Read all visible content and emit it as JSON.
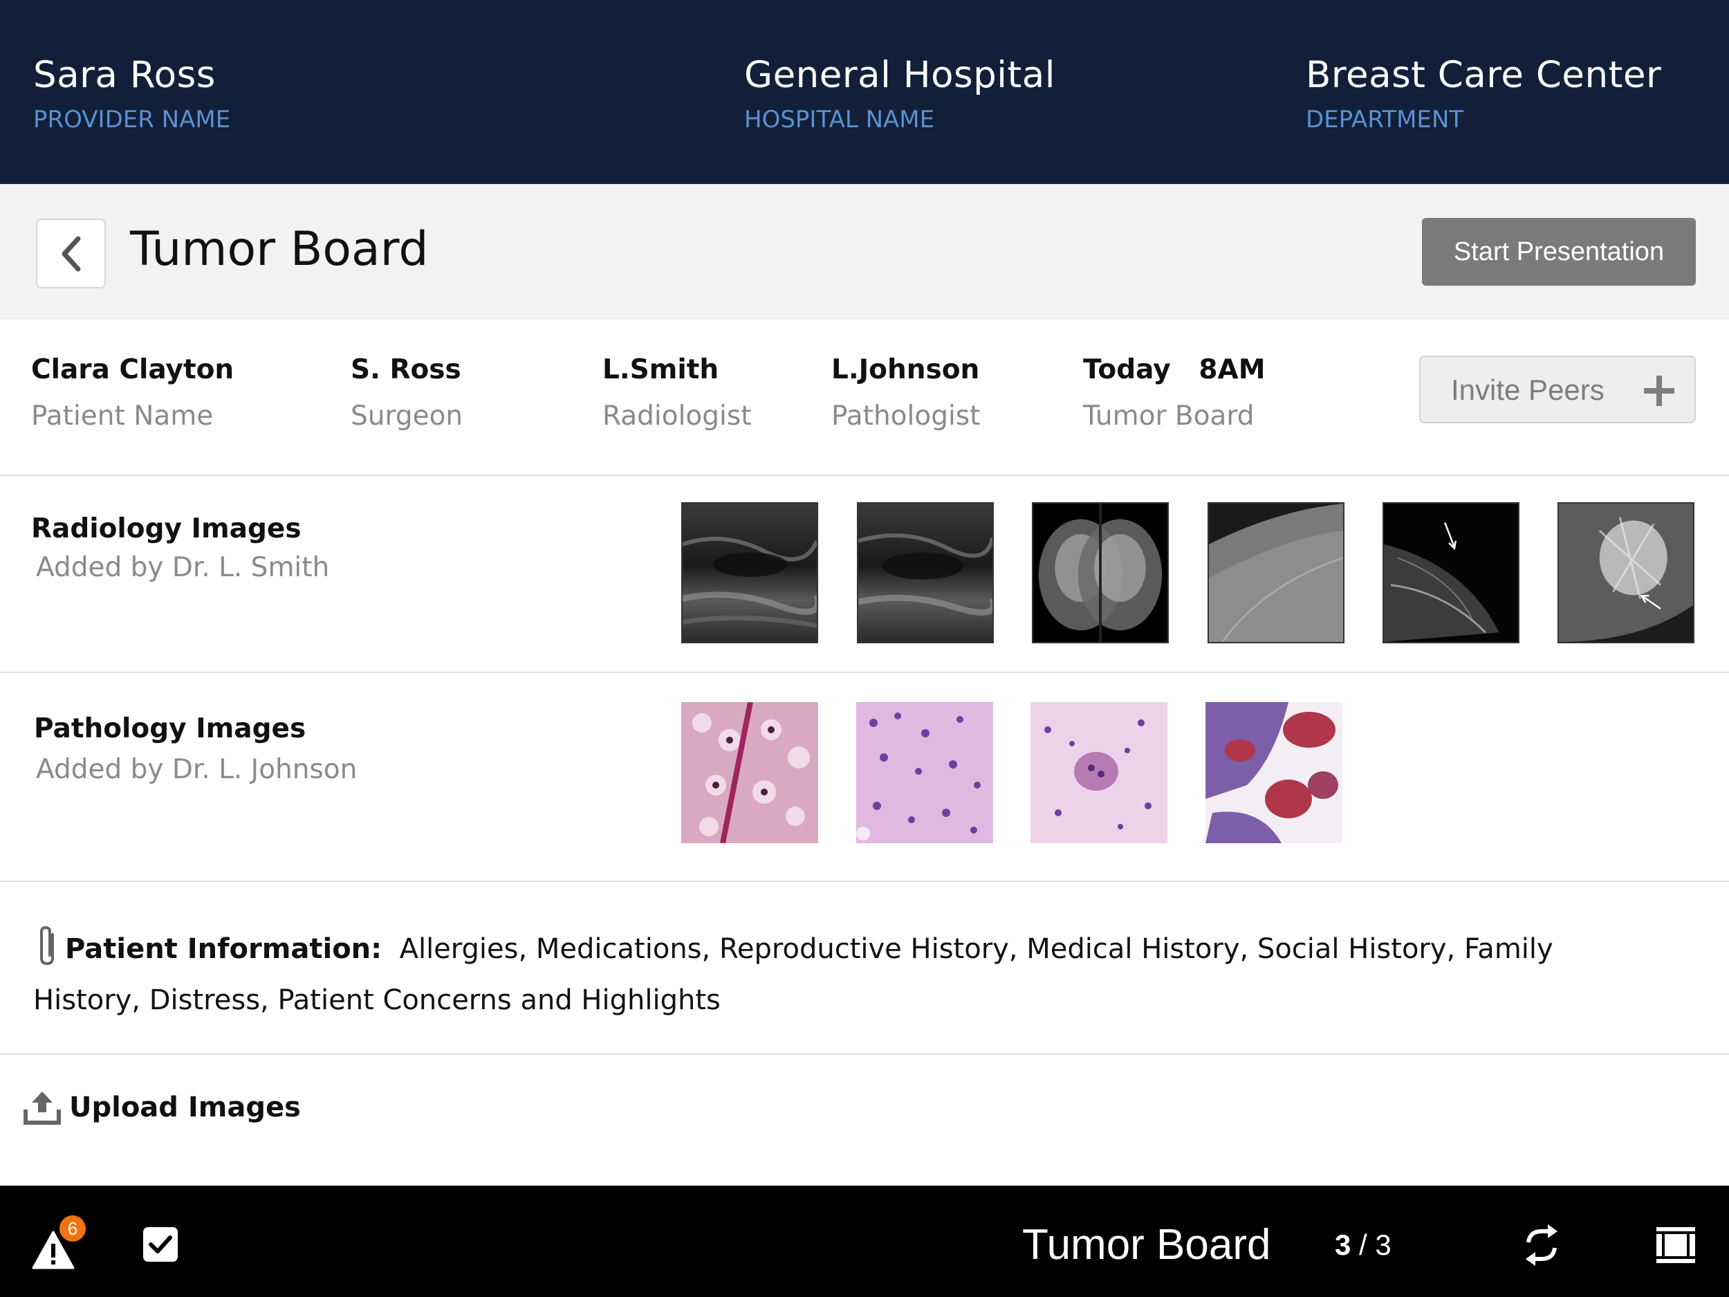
{
  "header": {
    "provider": {
      "value": "Sara Ross",
      "label": "PROVIDER NAME"
    },
    "hospital": {
      "value": "General Hospital",
      "label": "HOSPITAL NAME"
    },
    "department": {
      "value": "Breast Care Center",
      "label": "DEPARTMENT"
    }
  },
  "titlebar": {
    "title": "Tumor Board",
    "start_label": "Start Presentation",
    "back_icon": "chevron-left-icon"
  },
  "people": [
    {
      "name": "Clara Clayton",
      "role": "Patient Name"
    },
    {
      "name": "S. Ross",
      "role": "Surgeon"
    },
    {
      "name": "L.Smith",
      "role": "Radiologist"
    },
    {
      "name": "L.Johnson",
      "role": "Pathologist"
    },
    {
      "name": "Today   8AM",
      "role": "Tumor Board"
    }
  ],
  "invite": {
    "label": "Invite Peers",
    "icon": "plus-icon"
  },
  "radiology": {
    "title": "Radiology Images",
    "subtitle": "Added by Dr. L. Smith",
    "image_count": 6
  },
  "pathology": {
    "title": "Pathology Images",
    "subtitle": "Added by Dr. L. Johnson",
    "image_count": 4
  },
  "patient_info": {
    "label": "Patient Information:",
    "text": "Allergies, Medications, Reproductive History, Medical History, Social History, Family History, Distress, Patient Concerns and Highlights",
    "icon": "paperclip-icon"
  },
  "upload": {
    "label": "Upload Images",
    "icon": "upload-icon"
  },
  "bottombar": {
    "alerts_badge": "6",
    "title": "Tumor Board",
    "page_current": "3",
    "page_sep": " / ",
    "page_total": "3",
    "icons": [
      "alert-icon",
      "checkbox-icon",
      "sync-icon",
      "layout-icon"
    ]
  },
  "colors": {
    "header_bg": "#112038",
    "header_label": "#5b8fd2",
    "titlebar_bg": "#f2f2f2",
    "button_gray": "#7a7a7a",
    "bottombar_bg": "#000000",
    "badge": "#f0730f"
  }
}
